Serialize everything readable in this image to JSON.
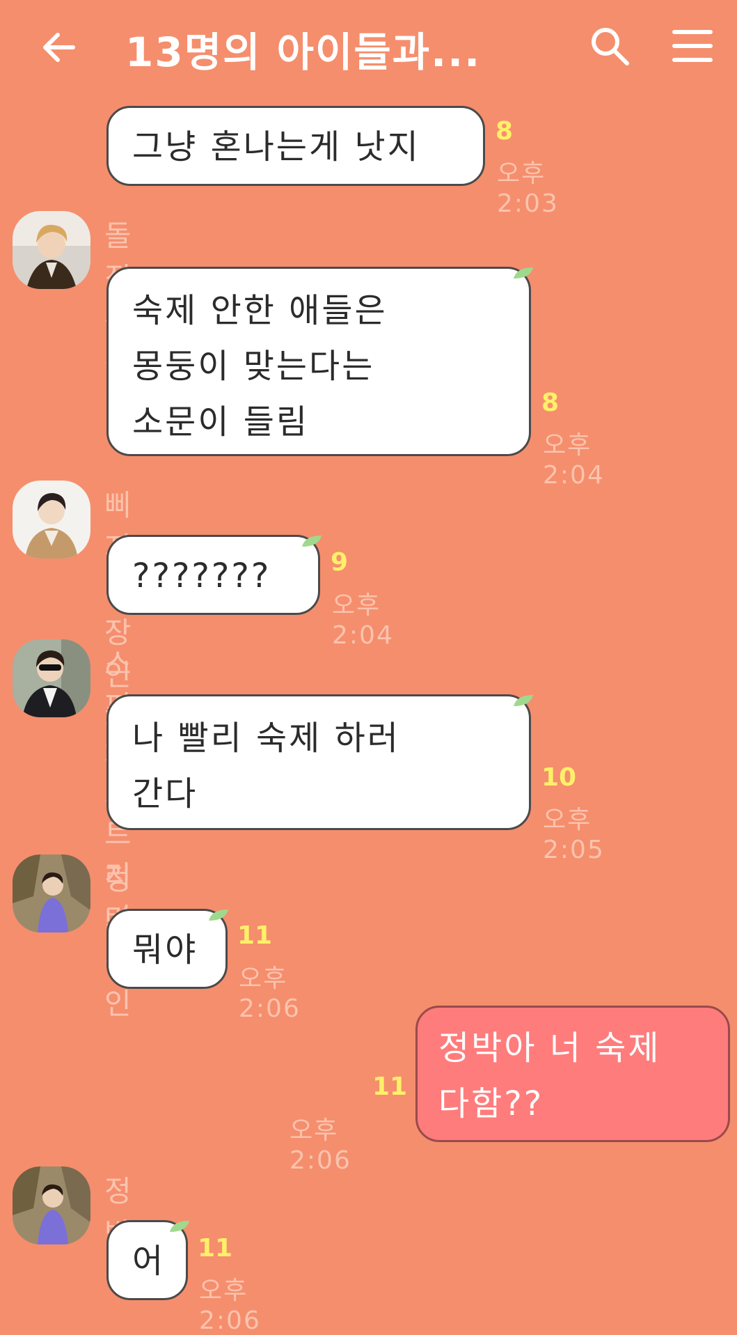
{
  "header": {
    "title": "13명의 아이들과...",
    "back_icon": "arrow-left-icon",
    "search_icon": "search-icon",
    "menu_icon": "hamburger-menu-icon"
  },
  "colors": {
    "background": "#F58E6D",
    "bubble_other": "#FFFFFF",
    "bubble_mine": "#FF7C7C",
    "unread": "#FFF06A",
    "meta_text": "#FBC3AE"
  },
  "messages": [
    {
      "sender": "",
      "text": "그냥 혼나는게 낫지",
      "unread": "8",
      "time": "오후 2:03"
    },
    {
      "sender": "돌직구 장인",
      "text": "숙제 안한 애들은\n몽둥이 맞는다는\n소문이 들림",
      "unread": "8",
      "time": "오후 2:04"
    },
    {
      "sender": "삐지기 장인 최승철",
      "text": "???????",
      "unread": "9",
      "time": "오후 2:04"
    },
    {
      "sender": "스피커 터트리기 장인",
      "text": "나 빨리 숙제 하러\n간다",
      "unread": "10",
      "time": "오후 2:05"
    },
    {
      "sender": "정박이",
      "text": "뭐야",
      "unread": "11",
      "time": "오후 2:06"
    },
    {
      "sender": "",
      "text": "정박아 너 숙제\n다함??",
      "unread": "11",
      "time": "오후 2:06",
      "mine": true
    },
    {
      "sender": "정박이",
      "text": "어",
      "unread": "11",
      "time": "오후 2:06"
    }
  ]
}
